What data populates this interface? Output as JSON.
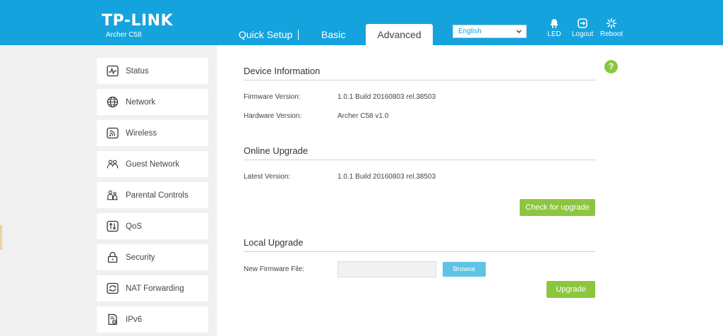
{
  "header": {
    "brand": "TP-LINK",
    "model": "Archer C58",
    "tabs": [
      {
        "label": "Quick Setup"
      },
      {
        "label": "Basic"
      },
      {
        "label": "Advanced",
        "active": true
      }
    ],
    "language": {
      "selected": "English"
    },
    "buttons": [
      {
        "label": "LED",
        "icon": "led-icon"
      },
      {
        "label": "Logout",
        "icon": "logout-icon"
      },
      {
        "label": "Reboot",
        "icon": "reboot-icon"
      }
    ]
  },
  "sidebar": {
    "items": [
      {
        "label": "Status",
        "icon": "status-icon"
      },
      {
        "label": "Network",
        "icon": "globe-icon"
      },
      {
        "label": "Wireless",
        "icon": "wireless-icon"
      },
      {
        "label": "Guest Network",
        "icon": "guest-network-icon"
      },
      {
        "label": "Parental Controls",
        "icon": "parental-controls-icon"
      },
      {
        "label": "QoS",
        "icon": "qos-icon"
      },
      {
        "label": "Security",
        "icon": "lock-icon"
      },
      {
        "label": "NAT Forwarding",
        "icon": "nat-forwarding-icon"
      },
      {
        "label": "IPv6",
        "icon": "ipv6-icon"
      }
    ]
  },
  "main": {
    "help": "?",
    "device_info": {
      "title": "Device Information",
      "firmware_label": "Firmware Version:",
      "firmware_value": "1.0.1 Build 20160803 rel.38503",
      "hardware_label": "Hardware Version:",
      "hardware_value": "Archer C58 v1.0"
    },
    "online_upgrade": {
      "title": "Online Upgrade",
      "latest_label": "Latest Version:",
      "latest_value": "1.0.1 Build 20160803 rel.38503",
      "check_button": "Check for upgrade"
    },
    "local_upgrade": {
      "title": "Local Upgrade",
      "file_label": "New Firmware File:",
      "file_value": "",
      "browse_button": "Browse",
      "upgrade_button": "Upgrade"
    }
  },
  "colors": {
    "header_bg": "#15a3dd",
    "accent_green": "#8cc63f",
    "browse_blue": "#5fc4e3"
  }
}
